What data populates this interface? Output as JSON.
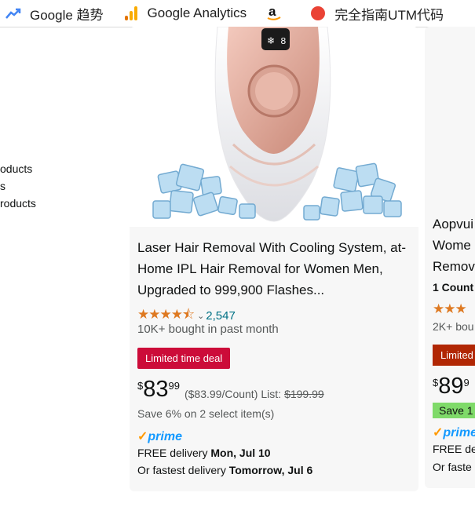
{
  "bookmarks": [
    {
      "label": "Google 趋势",
      "icon": "trend-arrow-icon"
    },
    {
      "label": "Google Analytics",
      "icon": "analytics-bars-icon"
    },
    {
      "label": "",
      "icon": "amazon-a-icon"
    },
    {
      "label": "完全指南UTM代码",
      "icon": "red-circle-icon"
    }
  ],
  "filters": [
    "oducts",
    "s",
    "roducts"
  ],
  "product1": {
    "title": "Laser Hair Removal With Cooling System, at-Home IPL Hair Removal for Women Men, Upgraded to 999,900 Flashes...",
    "stars": "★★★★⯪",
    "rating_count": "2,547",
    "bought": "10K+ bought in past month",
    "deal": "Limited time deal",
    "price_symbol": "$",
    "price_whole": "83",
    "price_fraction": "99",
    "per_unit": "($83.99/Count)",
    "list_label": "List:",
    "list_price": "$199.99",
    "save_text": "Save 6% on 2 select item(s)",
    "prime_check": "✓",
    "prime_label": "prime",
    "delivery_prefix": "FREE delivery",
    "delivery_date": "Mon, Jul 10",
    "fastest_prefix": "Or fastest delivery",
    "fastest_date": "Tomorrow, Jul 6"
  },
  "product2": {
    "title_lines": [
      "Aopvui",
      "Wome",
      "Remov"
    ],
    "count": "1 Count",
    "stars": "★★★",
    "bought": "2K+ bou",
    "deal": "Limited",
    "price_symbol": "$",
    "price_whole": "89",
    "price_fraction": "9",
    "save": "Save 1",
    "prime_check": "✓",
    "prime_label": "prime",
    "delivery": "FREE de",
    "fastest": "Or faste"
  }
}
